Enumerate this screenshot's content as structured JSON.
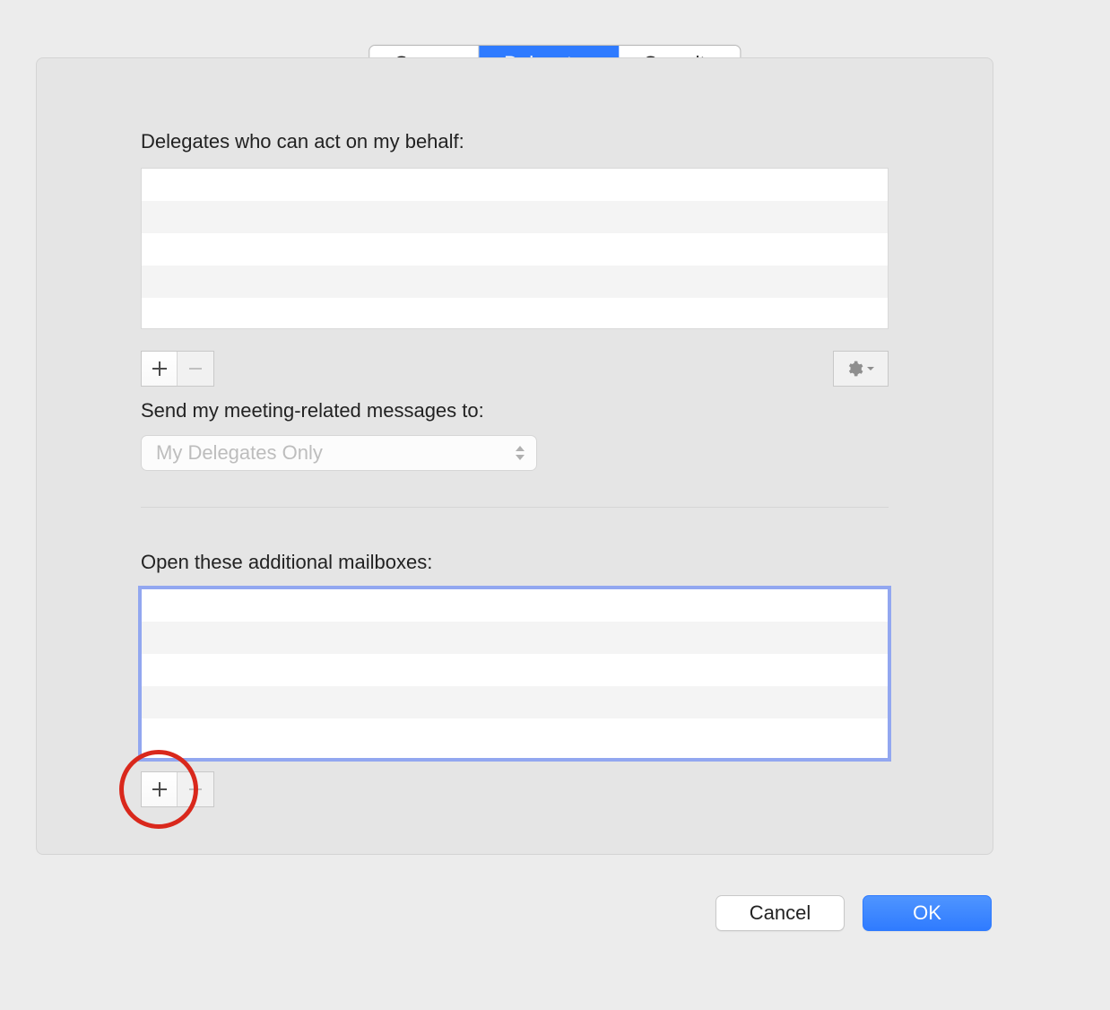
{
  "tabs": {
    "items": [
      {
        "label": "Server",
        "active": false
      },
      {
        "label": "Delegates",
        "active": true
      },
      {
        "label": "Security",
        "active": false
      }
    ]
  },
  "delegates_section": {
    "label": "Delegates who can act on my behalf:",
    "list_rows": [
      "",
      "",
      "",
      "",
      ""
    ]
  },
  "meeting_messages": {
    "label": "Send my meeting-related messages to:",
    "selected": "My Delegates Only"
  },
  "mailboxes_section": {
    "label": "Open these additional mailboxes:",
    "list_rows": [
      "",
      "",
      "",
      "",
      ""
    ]
  },
  "footer": {
    "cancel": "Cancel",
    "ok": "OK"
  }
}
